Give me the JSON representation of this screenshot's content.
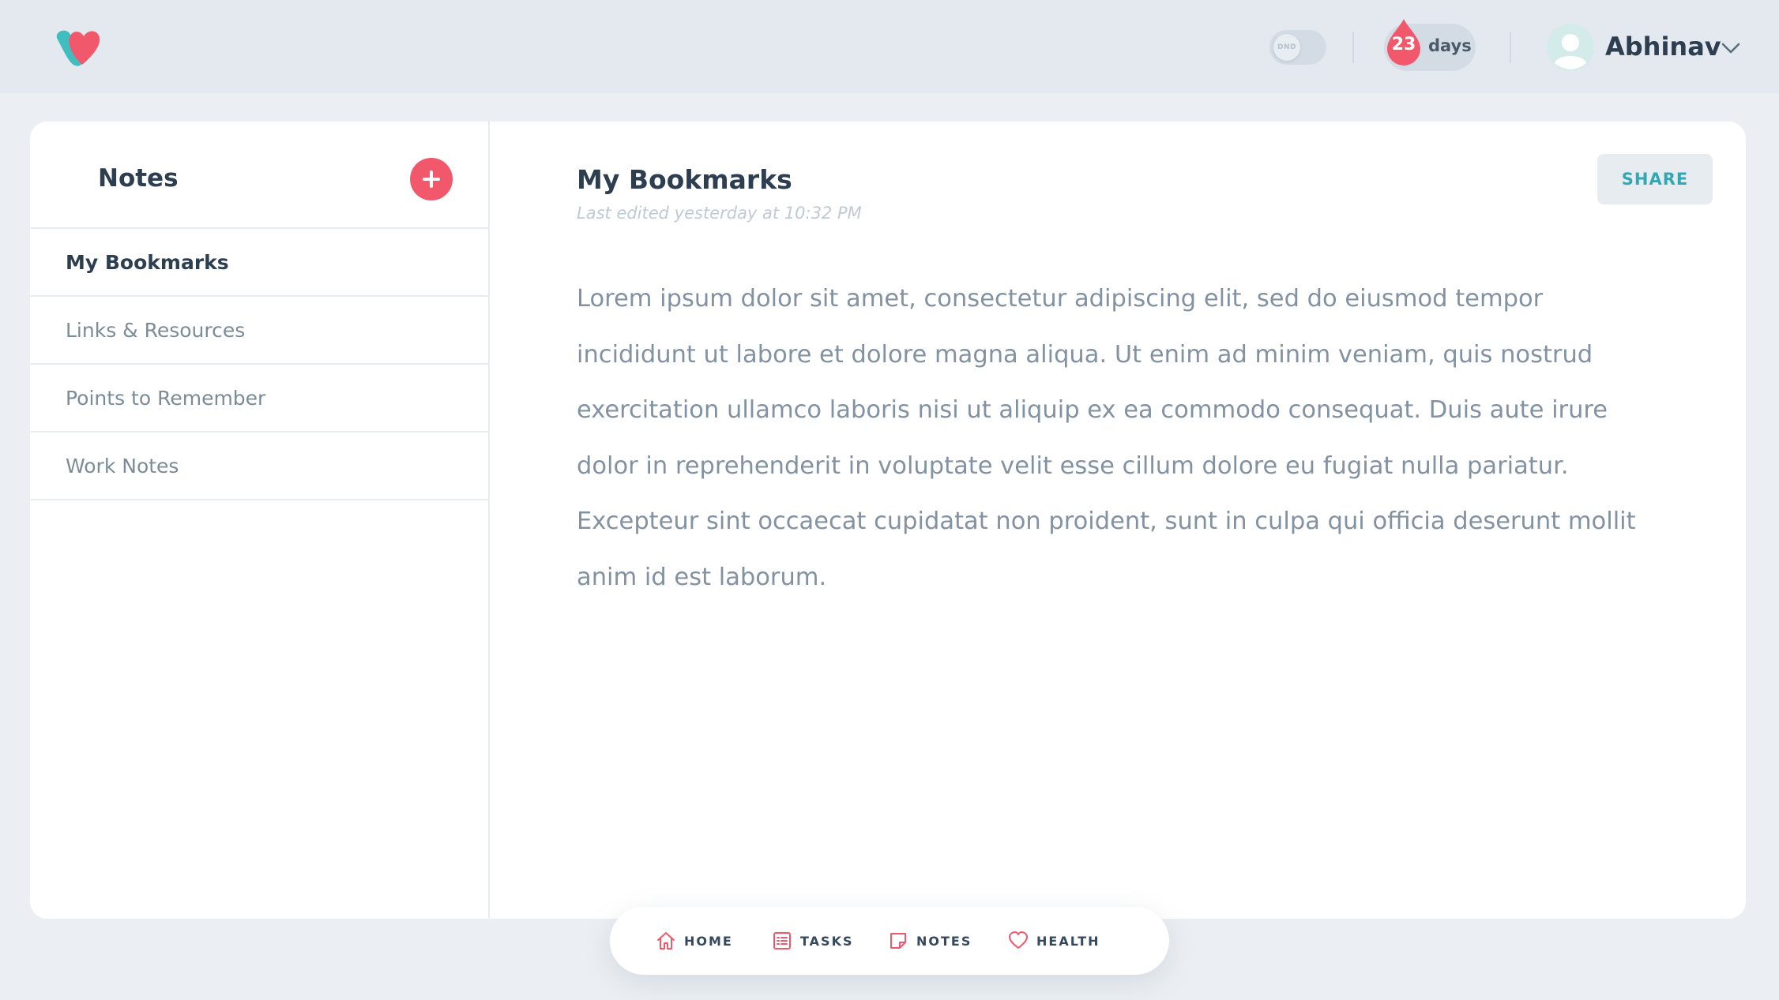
{
  "header": {
    "dnd_label": "DND",
    "streak_count": "23",
    "streak_unit": "days",
    "user_name": "Abhinav"
  },
  "sidebar": {
    "title": "Notes",
    "notes": [
      {
        "label": "My Bookmarks",
        "active": true
      },
      {
        "label": "Links & Resources",
        "active": false
      },
      {
        "label": "Points to Remember",
        "active": false
      },
      {
        "label": "Work Notes",
        "active": false
      }
    ]
  },
  "note": {
    "title": "My Bookmarks",
    "last_edited": "Last edited yesterday at 10:32 PM",
    "share_label": "SHARE",
    "body": "Lorem ipsum dolor sit amet, consectetur adipiscing elit, sed do eiusmod tempor incididunt ut labore et dolore magna aliqua. Ut enim ad minim veniam, quis nostrud exercitation ullamco laboris nisi ut aliquip ex ea commodo consequat. Duis aute irure dolor in reprehenderit in voluptate velit esse cillum dolore eu fugiat nulla pariatur. Excepteur sint occaecat cupidatat non proident, sunt in culpa qui officia deserunt mollit anim id est laborum."
  },
  "bottom_nav": {
    "items": [
      {
        "label": "HOME",
        "icon": "home-icon"
      },
      {
        "label": "TASKS",
        "icon": "tasks-icon"
      },
      {
        "label": "NOTES",
        "icon": "notes-icon"
      },
      {
        "label": "HEALTH",
        "icon": "heart-icon"
      }
    ]
  },
  "colors": {
    "accent_red": "#f2586c",
    "accent_teal": "#32a7b5",
    "text_dark": "#2c3e50",
    "text_muted": "#8292a2",
    "background": "#ebeff3"
  }
}
